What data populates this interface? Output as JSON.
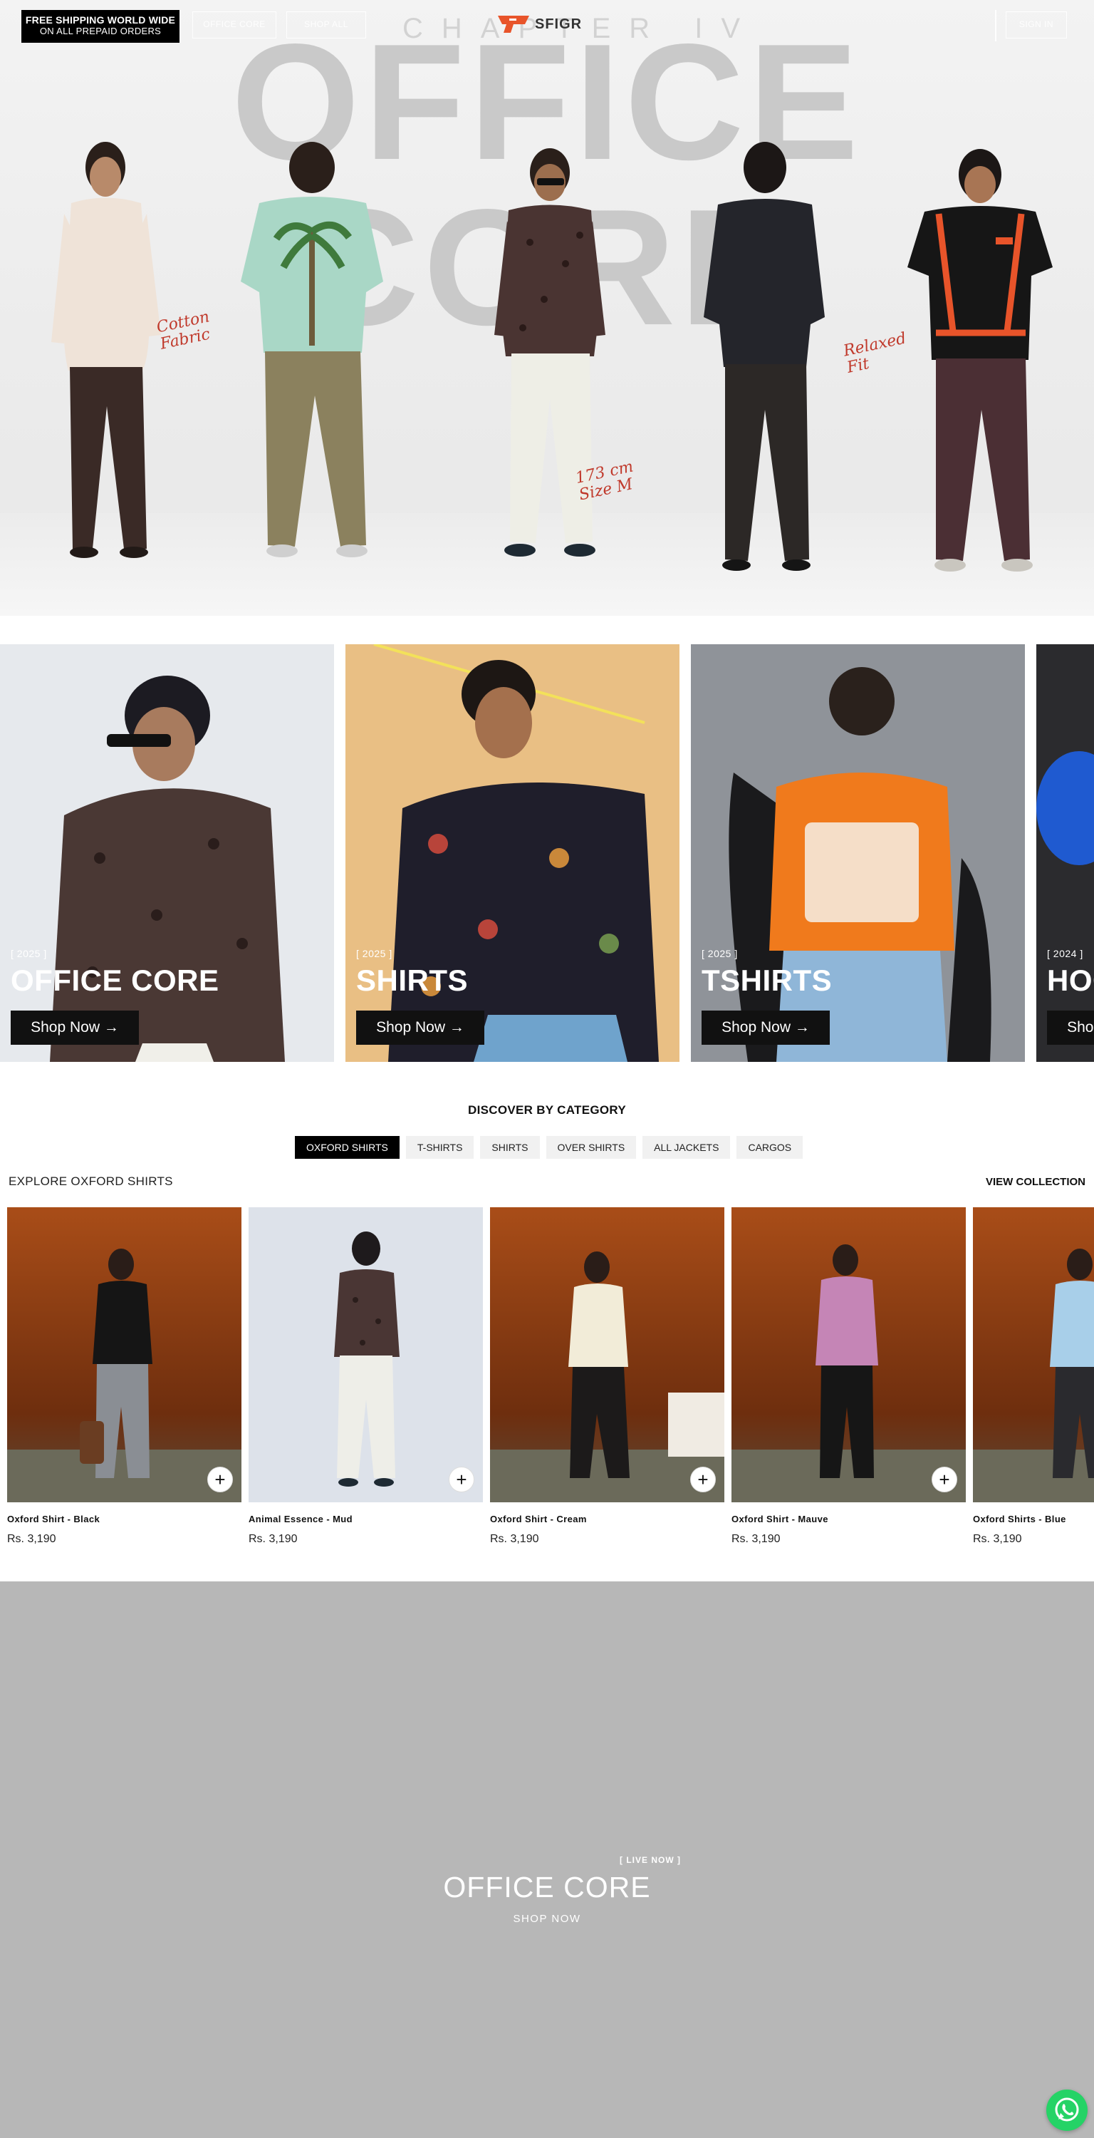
{
  "header": {
    "shipping_line1": "FREE SHIPPING WORLD WIDE",
    "shipping_line2": "ON ALL PREPAID ORDERS",
    "nav_left": [
      "OFFICE CORE",
      "SHOP ALL"
    ],
    "brand": "SFIGR",
    "chapter": "CHAPTER IV",
    "nav_right": "SIGN IN"
  },
  "hero": {
    "title": "OFFICE CORE",
    "notes": [
      "Cotton Fabric",
      "173 cm Size M",
      "Relaxed Fit"
    ]
  },
  "category_cards": [
    {
      "year": "[ 2025 ]",
      "title": "OFFICE CORE",
      "button": "Shop Now →"
    },
    {
      "year": "[ 2025 ]",
      "title": "SHIRTS",
      "button": "Shop Now →"
    },
    {
      "year": "[ 2025 ]",
      "title": "TSHIRTS",
      "button": "Shop Now →"
    },
    {
      "year": "[ 2024 ]",
      "title": "HOODIES",
      "button": "Shop Now →"
    }
  ],
  "discover": {
    "title": "DISCOVER BY CATEGORY",
    "tabs": [
      "OXFORD SHIRTS",
      "T-SHIRTS",
      "SHIRTS",
      "OVER SHIRTS",
      "ALL JACKETS",
      "CARGOS"
    ],
    "active_tab": "OXFORD SHIRTS",
    "explore_label": "EXPLORE OXFORD SHIRTS",
    "view_collection": "VIEW COLLECTION"
  },
  "products": [
    {
      "name": "Oxford Shirt - Black",
      "price": "Rs. 3,190"
    },
    {
      "name": "Animal Essence - Mud",
      "price": "Rs. 3,190"
    },
    {
      "name": "Oxford Shirt - Cream",
      "price": "Rs. 3,190"
    },
    {
      "name": "Oxford Shirt - Mauve",
      "price": "Rs. 3,190"
    },
    {
      "name": "Oxford Shirts - Blue",
      "price": "Rs. 3,190"
    }
  ],
  "banner": {
    "live": "[ LIVE NOW ]",
    "title": "OFFICE CORE",
    "cta": "SHOP NOW"
  },
  "colors": {
    "accent": "#e8542a",
    "banner_bg": "#b7b7b7",
    "whatsapp": "#25d366"
  }
}
